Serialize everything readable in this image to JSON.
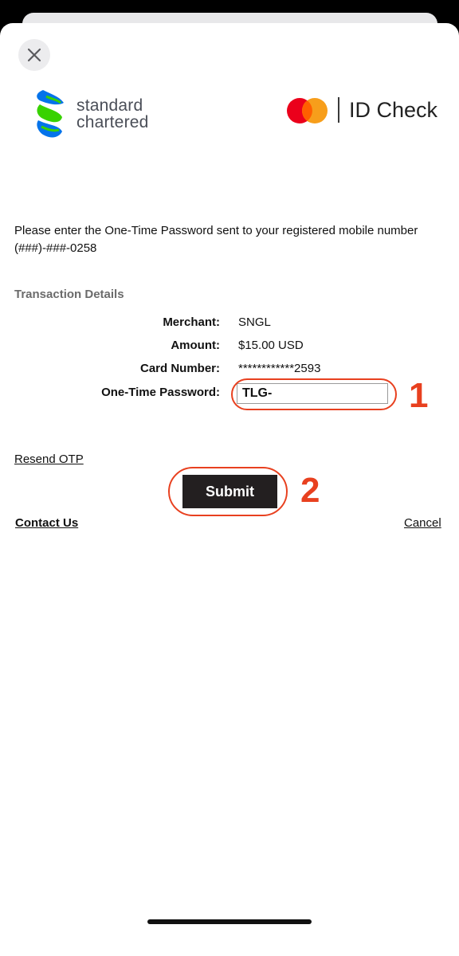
{
  "header": {
    "close_icon": "close-icon",
    "bank_logo_line1": "standard",
    "bank_logo_line2": "chartered",
    "scheme_logo_text": "ID Check"
  },
  "colors": {
    "mastercard_red": "#eb001b",
    "mastercard_orange": "#f79e1b",
    "sc_blue": "#0473ea",
    "sc_green": "#38d200",
    "annotation": "#e8401f",
    "submit_bg": "#231f20"
  },
  "main": {
    "instruction": "Please enter the One-Time Password sent to your registered mobile number (###)-###-0258",
    "section_title": "Transaction Details",
    "details": [
      {
        "label": "Merchant:",
        "value": "SNGL"
      },
      {
        "label": "Amount:",
        "value": "$15.00 USD"
      },
      {
        "label": "Card Number:",
        "value": "************2593"
      }
    ],
    "otp_label": "One-Time Password:",
    "otp_value": "TLG-"
  },
  "actions": {
    "resend": "Resend OTP",
    "submit": "Submit",
    "contact": "Contact Us",
    "cancel": "Cancel"
  },
  "annotations": {
    "step1": "1",
    "step2": "2"
  }
}
